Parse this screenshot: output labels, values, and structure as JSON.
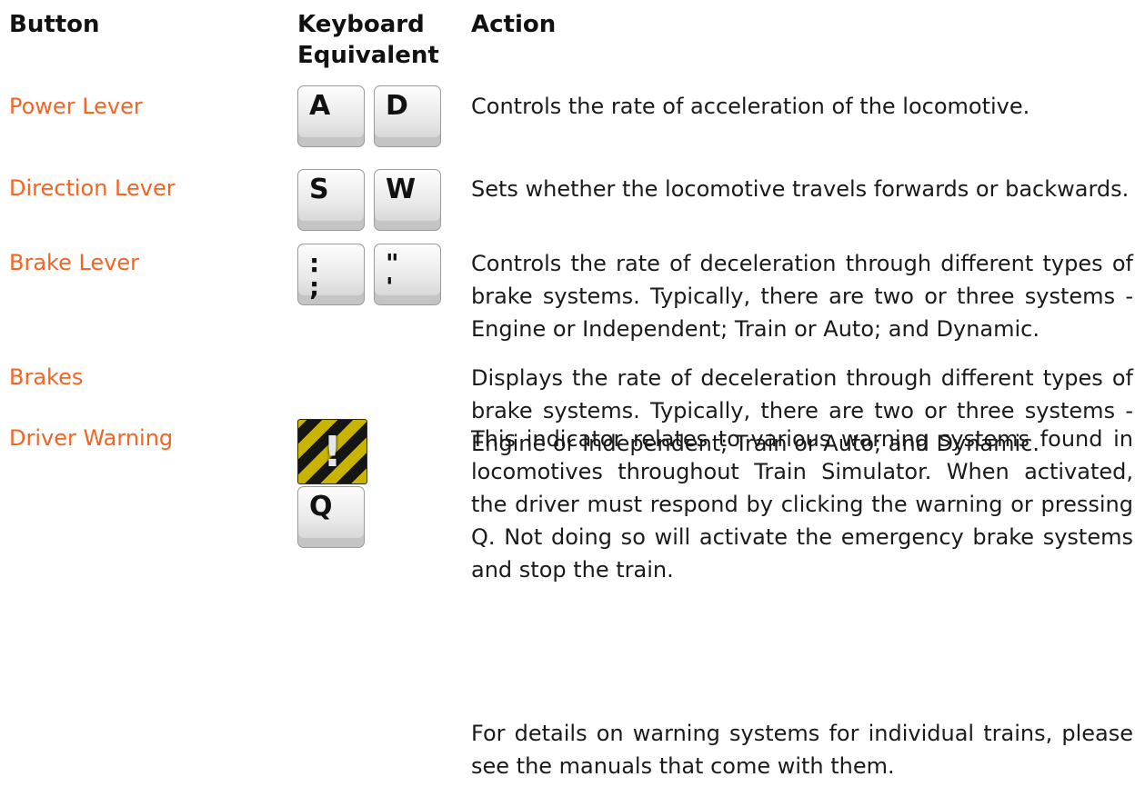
{
  "headers": {
    "button": "Button",
    "keyboard": "Keyboard\nEquivalent",
    "action": "Action"
  },
  "rows": [
    {
      "button": "Power Lever",
      "keys": [
        "A",
        "D"
      ],
      "action": "Controls the rate of acceleration of the locomotive."
    },
    {
      "button": "Direction Lever",
      "keys": [
        "S",
        "W"
      ],
      "action": "Sets whether the locomotive travels forwards or backwards."
    },
    {
      "button": "Brake Lever",
      "keys": [
        ":\n;",
        "\"\n'"
      ],
      "action": "Controls the rate of deceleration through different types of brake systems. Typically, there are two or three systems - Engine or Independent; Train or Auto; and Dynamic."
    },
    {
      "button": "Brakes",
      "keys": [],
      "action": "Displays the rate of deceleration through different types of brake systems. Typically, there are two or three systems - Engine or Independent; Train or Auto; and Dynamic."
    },
    {
      "button": "Driver Warning",
      "keys": [
        "Q"
      ],
      "action": "This indicator relates to various warning systems found in locomotives throughout Train Simulator. When activated, the driver must respond by clicking the warning or pressing Q. Not doing so will activate the emergency brake systems and stop the train.",
      "icon": "warning-stripes-icon"
    }
  ],
  "note": "For details on warning systems for individual trains, please see the manuals that come with them.",
  "colors": {
    "button_label": "#f26522",
    "warning_yellow": "#c8b400",
    "warning_black": "#151515"
  }
}
